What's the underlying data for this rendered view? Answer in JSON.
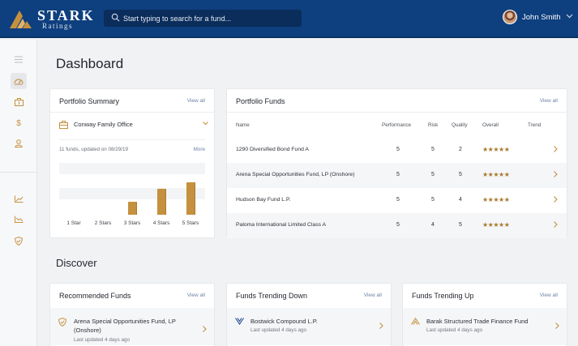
{
  "header": {
    "logo_word": "STARK",
    "logo_sub": "Ratings",
    "search_placeholder": "Start typing to search for a fund...",
    "user_name": "John Smith"
  },
  "page": {
    "title": "Dashboard",
    "discover_title": "Discover"
  },
  "portfolio_summary": {
    "title": "Portfolio Summary",
    "view_all": "View all",
    "org_name": "Conway Family Office",
    "meta": "11 funds, updated on 08/29/19",
    "more": "More",
    "chart_data": {
      "type": "bar",
      "categories": [
        "1 Star",
        "2 Stars",
        "3 Stars",
        "4 Stars",
        "5 Stars"
      ],
      "values": [
        0,
        0,
        2,
        4,
        5
      ],
      "ylim": [
        0,
        8
      ],
      "color": "#c5913f"
    }
  },
  "portfolio_funds": {
    "title": "Portfolio Funds",
    "view_all": "View all",
    "columns": [
      "Name",
      "Performance",
      "Risk",
      "Quality",
      "Overall",
      "Trend"
    ],
    "rows": [
      {
        "name": "1290 Diversified Bond Fund A",
        "performance": "5",
        "risk": "5",
        "quality": "2",
        "overall": "★★★★★"
      },
      {
        "name": "Arena Special Opportunities Fund, LP (Onshore)",
        "performance": "5",
        "risk": "5",
        "quality": "5",
        "overall": "★★★★★"
      },
      {
        "name": "Hudson Bay Fund L.P.",
        "performance": "5",
        "risk": "5",
        "quality": "4",
        "overall": "★★★★★"
      },
      {
        "name": "Paloma International Limited Class A",
        "performance": "5",
        "risk": "4",
        "quality": "5",
        "overall": "★★★★★"
      }
    ]
  },
  "discover": {
    "recommended": {
      "title": "Recommended Funds",
      "view_all": "View all",
      "item_name_1": "Arena Special Opportunities Fund, LP",
      "item_name_2": "(Onshore)",
      "item_sub": "Last updated 4 days ago",
      "icon": "shield-check-icon"
    },
    "trending_down": {
      "title": "Funds Trending Down",
      "view_all": "View all",
      "item_name": "Bostwick Compound L.P.",
      "item_sub": "Last updated 4 days ago",
      "icon": "chevrons-down-icon"
    },
    "trending_up": {
      "title": "Funds Trending Up",
      "view_all": "View all",
      "item_name": "Barak Structured Trade Finance Fund",
      "item_sub": "Last updated 4 days ago",
      "icon": "chevrons-up-icon"
    }
  },
  "colors": {
    "header": "#0e3f7e",
    "accent_gold": "#c5913f",
    "link": "#6e82a6"
  }
}
